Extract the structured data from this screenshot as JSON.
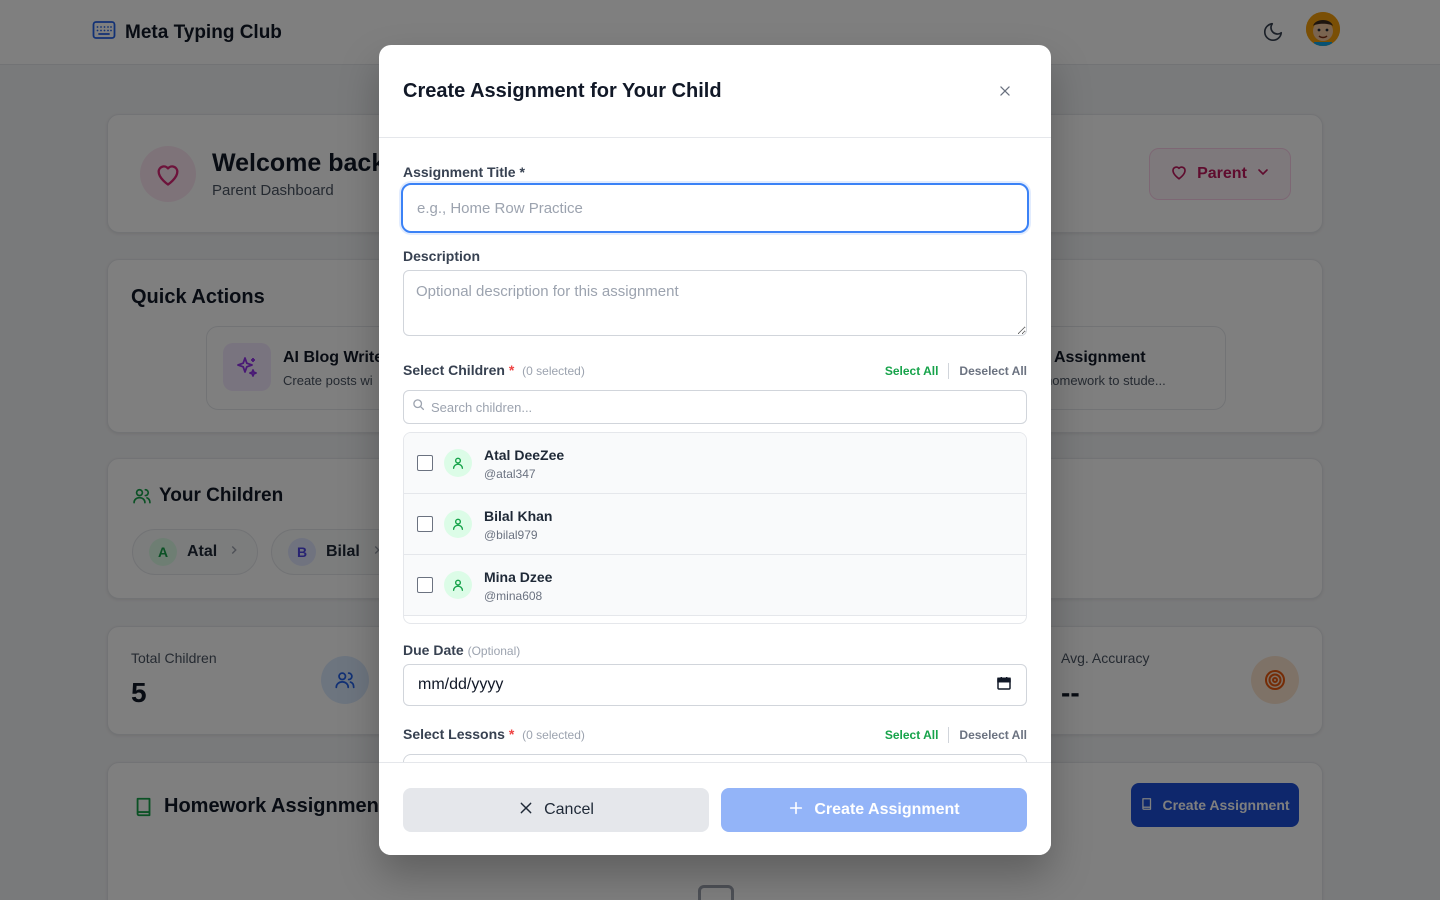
{
  "app": {
    "name": "Meta Typing Club",
    "logo_icon": "keyboard-icon",
    "theme_icon": "moon-icon"
  },
  "welcome": {
    "title": "Welcome back,",
    "subtitle": "Parent Dashboard",
    "role_label": "Parent"
  },
  "quick_actions": {
    "title": "Quick Actions",
    "items": [
      {
        "title": "AI Blog Write",
        "desc": "Create posts wi"
      },
      {
        "title": "ate Assignment",
        "desc": "gn homework to stude..."
      }
    ]
  },
  "children_section": {
    "title": "Your Children",
    "chips": [
      {
        "letter": "A",
        "name": "Atal"
      },
      {
        "letter": "B",
        "name": "Bilal"
      }
    ]
  },
  "stats": {
    "total_children_label": "Total Children",
    "total_children_value": "5",
    "avg_accuracy_label": "Avg. Accuracy",
    "avg_accuracy_value": "--"
  },
  "homework": {
    "title": "Homework Assignment",
    "create_label": "Create Assignment"
  },
  "modal": {
    "title": "Create Assignment for Your Child",
    "close_icon": "close-icon",
    "assignment_title_label": "Assignment Title",
    "required_mark": "*",
    "assignment_title_placeholder": "e.g., Home Row Practice",
    "assignment_title_value": "",
    "description_label": "Description",
    "description_placeholder": "Optional description for this assignment",
    "select_children_label": "Select Children",
    "children_selected": "(0 selected)",
    "select_all": "Select All",
    "deselect_all": "Deselect All",
    "search_placeholder": "Search children...",
    "children": [
      {
        "name": "Atal DeeZee",
        "username": "@atal347",
        "checked": false
      },
      {
        "name": "Bilal Khan",
        "username": "@bilal979",
        "checked": false
      },
      {
        "name": "Mina Dzee",
        "username": "@mina608",
        "checked": false
      }
    ],
    "due_date_label": "Due Date",
    "due_date_optional": "(Optional)",
    "due_date_value": "mm/dd/yyyy",
    "select_lessons_label": "Select Lessons",
    "lessons_selected": "(0 selected)",
    "cancel_label": "Cancel",
    "create_label": "Create Assignment"
  },
  "colors": {
    "primary": "#1d4ed8",
    "primary_disabled": "#93b4f8",
    "accent_green": "#16a34a",
    "accent_pink": "#be185d",
    "focus_ring": "#3b82f6"
  }
}
